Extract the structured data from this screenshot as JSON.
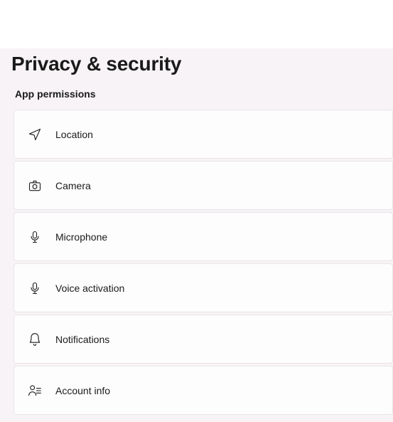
{
  "page": {
    "title": "Privacy & security",
    "section": "App permissions"
  },
  "permissions": {
    "location": {
      "label": "Location"
    },
    "camera": {
      "label": "Camera"
    },
    "microphone": {
      "label": "Microphone"
    },
    "voice_activation": {
      "label": "Voice activation"
    },
    "notifications": {
      "label": "Notifications"
    },
    "account_info": {
      "label": "Account info"
    }
  }
}
